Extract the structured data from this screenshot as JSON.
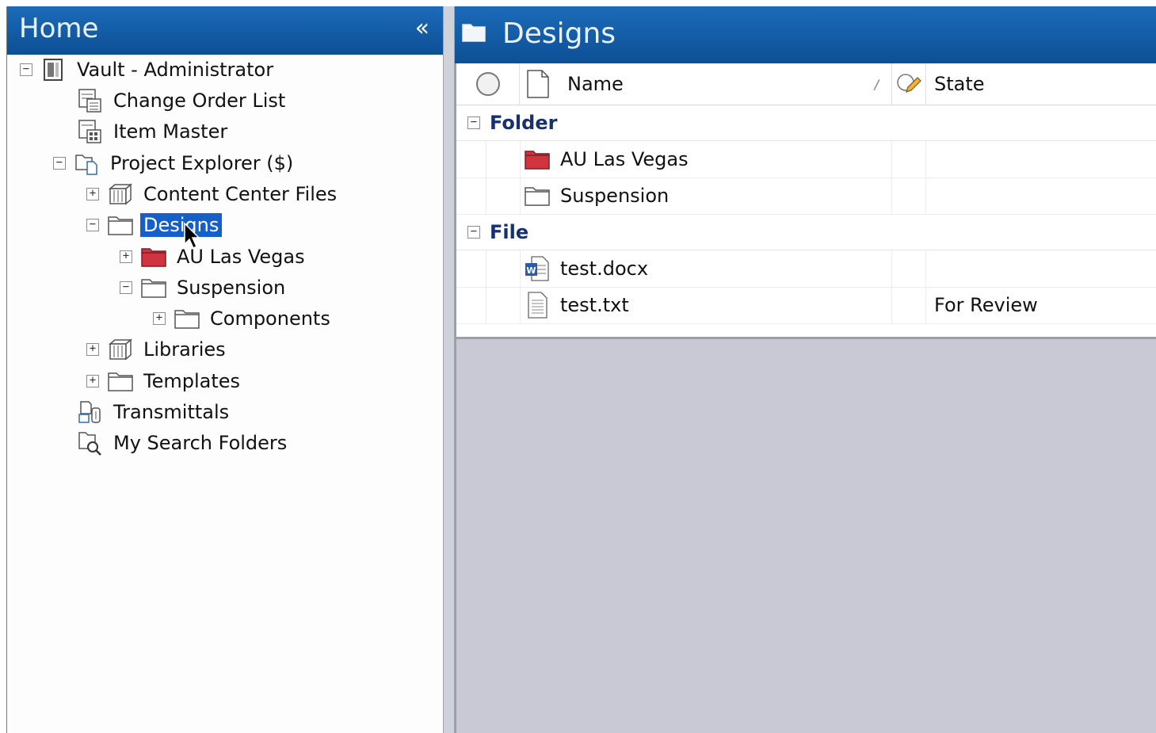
{
  "left": {
    "title": "Home",
    "collapse_glyph": "«",
    "tree": [
      {
        "label": "Vault - Administrator",
        "icon": "vault-icon",
        "expander": "⊟"
      },
      {
        "label": "Change Order List",
        "icon": "change-order-list-icon",
        "expander": ""
      },
      {
        "label": "Item Master",
        "icon": "item-master-icon",
        "expander": ""
      },
      {
        "label": "Project Explorer ($)",
        "icon": "project-explorer-icon",
        "expander": "⊟"
      },
      {
        "label": "Content Center Files",
        "icon": "library-folder-icon",
        "expander": "⊞"
      },
      {
        "label": "Designs",
        "icon": "folder-icon",
        "expander": "⊟",
        "selected": true
      },
      {
        "label": "AU Las Vegas",
        "icon": "red-folder-icon",
        "expander": "⊞"
      },
      {
        "label": "Suspension",
        "icon": "folder-icon",
        "expander": "⊟"
      },
      {
        "label": "Components",
        "icon": "folder-icon",
        "expander": "⊞"
      },
      {
        "label": "Libraries",
        "icon": "library-folder-icon",
        "expander": "⊞"
      },
      {
        "label": "Templates",
        "icon": "folder-icon",
        "expander": "⊞"
      },
      {
        "label": "Transmittals",
        "icon": "transmittals-icon",
        "expander": ""
      },
      {
        "label": "My Search Folders",
        "icon": "search-folders-icon",
        "expander": ""
      }
    ]
  },
  "right": {
    "title": "Designs",
    "columns": {
      "name": "Name",
      "state": "State",
      "sort_glyph": "/"
    },
    "groups": [
      {
        "label": "Folder",
        "rows": [
          {
            "name": "AU Las Vegas",
            "icon": "red-folder-icon",
            "state": ""
          },
          {
            "name": "Suspension",
            "icon": "folder-icon",
            "state": ""
          }
        ]
      },
      {
        "label": "File",
        "rows": [
          {
            "name": "test.docx",
            "icon": "word-doc-icon",
            "state": ""
          },
          {
            "name": "test.txt",
            "icon": "text-file-icon",
            "state": "For Review"
          }
        ]
      }
    ]
  },
  "colors": {
    "header_blue": "#0c4f95",
    "selection": "#1460c8",
    "group_text": "#17306e",
    "folder_red": "#d0353f"
  }
}
